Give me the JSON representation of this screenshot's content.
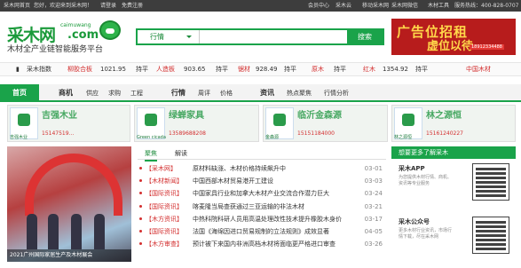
{
  "topbar": {
    "links": [
      "采木网首页",
      "您好，欢迎来到采木网！",
      "请登录",
      "免费注册"
    ],
    "right": [
      "会员中心",
      "采木云",
      "移动采木网",
      "采木网微信",
      "木材工具",
      "服务热线：400-828-0707"
    ]
  },
  "logo": {
    "text": "采木网",
    "en": "caimuwang",
    "com": ".com"
  },
  "slogan": "木材全产业链智能服务平台",
  "search": {
    "category": "行情",
    "placeholder": "",
    "button": "搜索"
  },
  "ad_top": {
    "title": "广告位招租",
    "subtitle": "虚位以待",
    "phone": "18912334488"
  },
  "ticker": [
    {
      "name": "采木指数",
      "value": "",
      "change": ""
    },
    {
      "name": "柳胶合板",
      "value": "1021.95",
      "change": "持平"
    },
    {
      "name": "人造板",
      "value": "903.65",
      "change": "持平"
    },
    {
      "name": "锯材",
      "value": "928.49",
      "change": "持平"
    },
    {
      "name": "原木",
      "value": "",
      "change": "持平"
    },
    {
      "name": "红木",
      "value": "1354.92",
      "change": "持平"
    },
    {
      "name": "中国木材",
      "value": "",
      "change": ""
    }
  ],
  "nav": {
    "home": "首页",
    "groups": [
      {
        "head": "商机",
        "items": [
          "供应",
          "求购",
          "工程"
        ]
      },
      {
        "head": "行情",
        "items": [
          "周评",
          "价格"
        ]
      },
      {
        "head": "资讯",
        "items": [
          "热点聚焦",
          "行情分析"
        ]
      }
    ]
  },
  "ads": [
    {
      "brand": "吉强木业",
      "name": "吉强木业",
      "phone": "15147519..."
    },
    {
      "brand": "Green cicada",
      "name": "绿蝉家具",
      "phone": "13589688208"
    },
    {
      "brand": "金森源",
      "name": "临沂金森源",
      "phone": "15151184000"
    },
    {
      "brand": "林之源恒",
      "name": "林之源恒",
      "phone": "15161240227"
    }
  ],
  "photo_caption": "2021广州国际家居生产及木材展会",
  "tabs": [
    "聚焦",
    "解读"
  ],
  "news": [
    {
      "tag": "【采木网】",
      "title": "原材料缺涨、木材价格持续飙升中",
      "date": "03-01"
    },
    {
      "tag": "【木材新闻】",
      "title": "中国西部木材贸易港开工建设",
      "date": "03-03"
    },
    {
      "tag": "【国际资讯】",
      "title": "中国家具行业和加拿大木材产业交流合作潜力巨大",
      "date": "03-24"
    },
    {
      "tag": "【国际资讯】",
      "title": "喀麦隆当局查获通过三亚运输的非法木材",
      "date": "03-21"
    },
    {
      "tag": "【木方资讯】",
      "title": "中热科院科研人员用高温处理改性技术提升橡胶木身价",
      "date": "03-17"
    },
    {
      "tag": "【国际资讯】",
      "title": "法国《海绵因进口贸易规制的立法规则》成效显著",
      "date": "04-05"
    },
    {
      "tag": "【木方审查】",
      "title": "预计被下来国内非洲高档木材将面临更严格进口审查",
      "date": "03-26"
    }
  ],
  "side": {
    "header": "想要更多了解采木",
    "app": {
      "title": "采木APP",
      "desc": "为您提供木材行情、商机、资讯等专业服务"
    },
    "wechat": {
      "title": "采木公众号",
      "desc": "更多木材行业资讯，市场行情下载，尽在采木网"
    }
  }
}
